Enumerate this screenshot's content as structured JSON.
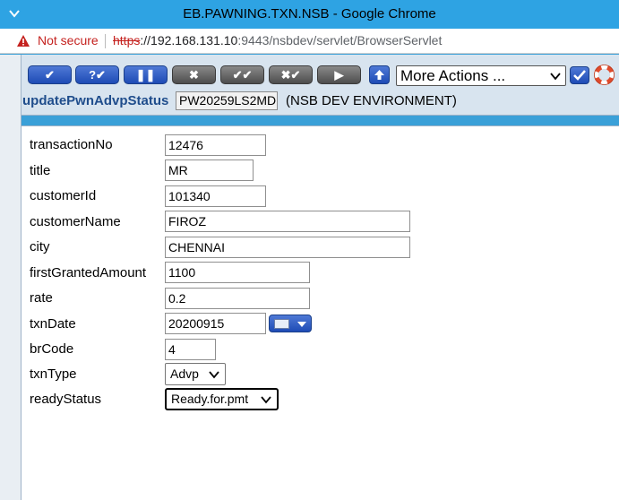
{
  "window": {
    "title": "EB.PAWNING.TXN.NSB - Google Chrome",
    "not_secure": "Not secure",
    "url_scheme": "https",
    "url_host": "://192.168.131.10",
    "url_rest": ":9443/nsbdev/servlet/BrowserServlet"
  },
  "toolbar": {
    "buttons": [
      {
        "symbol": "✔",
        "style": "blue"
      },
      {
        "symbol": "?✔",
        "style": "blue"
      },
      {
        "symbol": "❚❚",
        "style": "blue"
      },
      {
        "symbol": "✖",
        "style": "gray"
      },
      {
        "symbol": "✔✔",
        "style": "gray"
      },
      {
        "symbol": "✖✔",
        "style": "gray"
      },
      {
        "symbol": "▶",
        "style": "gray"
      }
    ],
    "more_actions": "More Actions ..."
  },
  "form": {
    "name": "updatePwnAdvpStatus",
    "record_id": "PW20259LS2MD",
    "environment": "(NSB DEV ENVIRONMENT)",
    "fields": {
      "transactionNo": {
        "label": "transactionNo",
        "value": "12476"
      },
      "title": {
        "label": "title",
        "value": "MR"
      },
      "customerId": {
        "label": "customerId",
        "value": "101340"
      },
      "customerName": {
        "label": "customerName",
        "value": "FIROZ"
      },
      "city": {
        "label": "city",
        "value": "CHENNAI"
      },
      "firstGrantedAmount": {
        "label": "firstGrantedAmount",
        "value": "1100"
      },
      "rate": {
        "label": "rate",
        "value": "0.2"
      },
      "txnDate": {
        "label": "txnDate",
        "value": "20200915"
      },
      "brCode": {
        "label": "brCode",
        "value": "4"
      },
      "txnType": {
        "label": "txnType",
        "value": "Advp"
      },
      "readyStatus": {
        "label": "readyStatus",
        "value": "Ready.for.pmt"
      }
    }
  },
  "icons": {
    "warning": "warning-triangle-icon",
    "calendar": "calendar-icon",
    "help": "lifebuoy-icon"
  }
}
